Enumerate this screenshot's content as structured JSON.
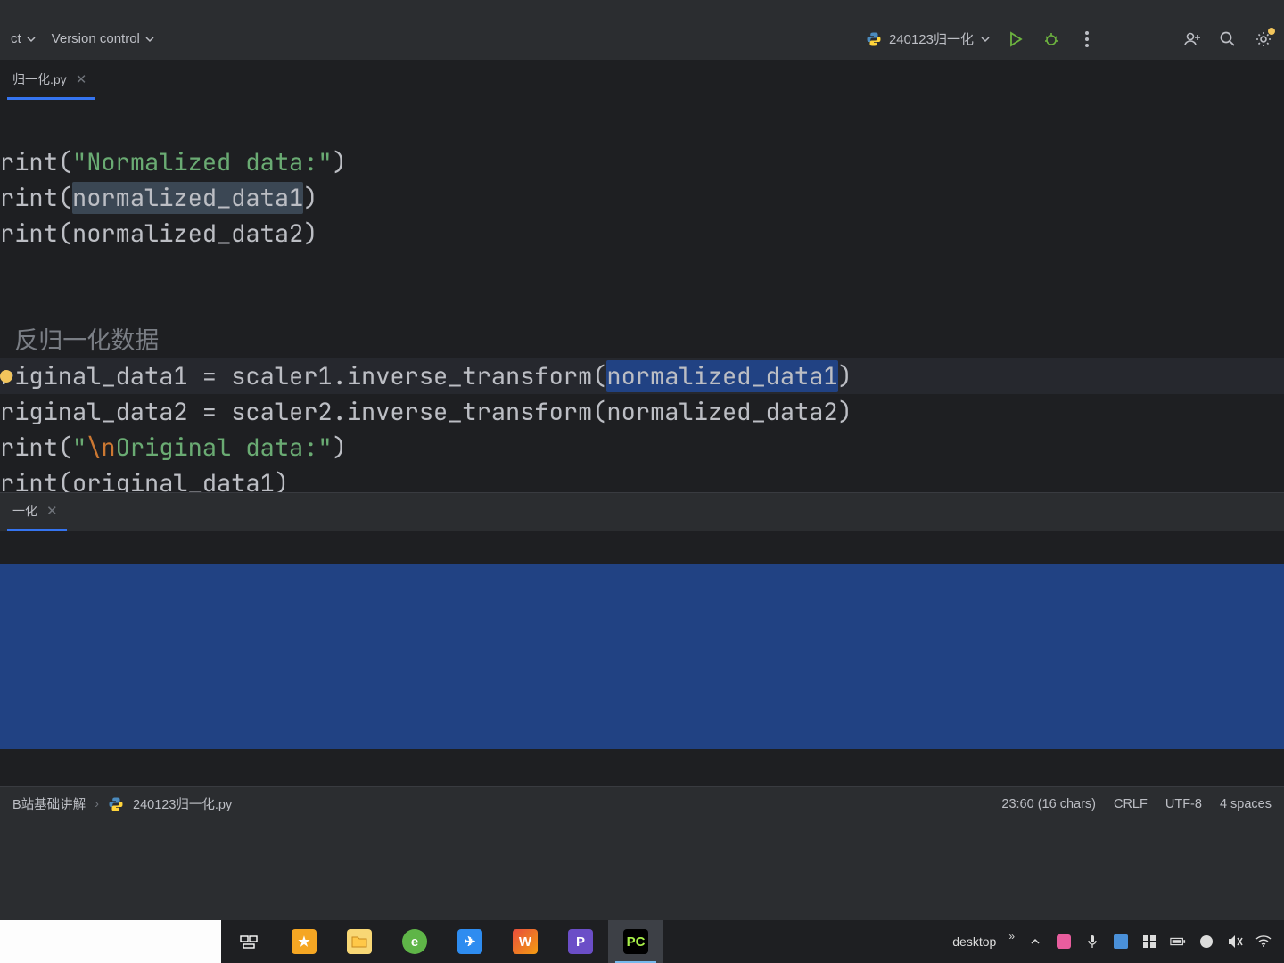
{
  "toolbar": {
    "project_label": "ct",
    "vcs_label": "Version control",
    "run_config": "240123归一化"
  },
  "tab": {
    "filename": "归一化.py"
  },
  "code": {
    "l1_fn": "rint",
    "l1_str": "\"Normalized data:\"",
    "l2_fn": "rint",
    "l2_arg": "normalized_data1",
    "l3_fn": "rint",
    "l3_arg": "normalized_data2",
    "comment": " 反归一化数据",
    "l4_var": "riginal_data1",
    "l4_expr": "scaler1.inverse_transform(",
    "l4_sel": "normalized_data1",
    "l5_var": "riginal_data2",
    "l5_expr": "scaler2.inverse_transform(normalized_data2)",
    "l6_fn": "rint",
    "l6_str1": "\"",
    "l6_esc": "\\n",
    "l6_str2": "Original data:\"",
    "l7_fn": "rint",
    "l7_arg": "original_data1"
  },
  "toolwindow": {
    "tab_label": "一化"
  },
  "breadcrumb": {
    "folder": "B站基础讲解",
    "file": "240123归一化.py"
  },
  "status": {
    "pos": "23:60 (16 chars)",
    "eol": "CRLF",
    "enc": "UTF-8",
    "indent": "4 spaces"
  },
  "taskbar": {
    "desktop": "desktop"
  }
}
